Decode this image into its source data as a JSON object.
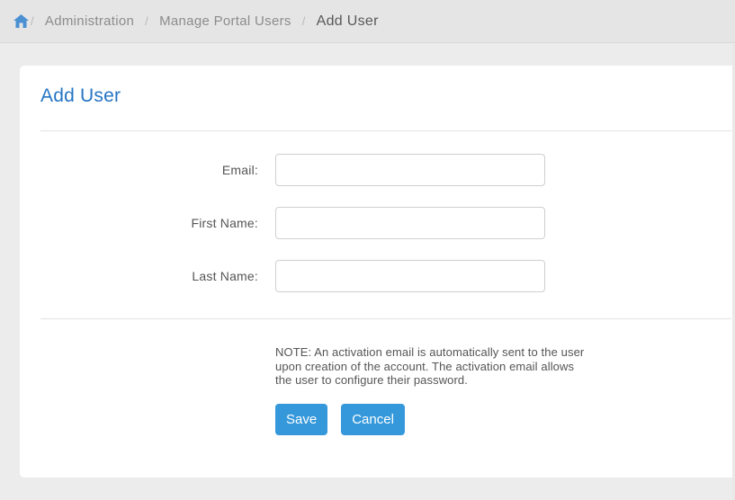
{
  "breadcrumb": {
    "separator": "/",
    "items": [
      {
        "label": "Administration"
      },
      {
        "label": "Manage Portal Users"
      },
      {
        "label": "Add User"
      }
    ]
  },
  "icons": {
    "home": "home-icon"
  },
  "page": {
    "title": "Add User"
  },
  "form": {
    "fields": [
      {
        "label": "Email:",
        "value": "",
        "placeholder": ""
      },
      {
        "label": "First Name:",
        "value": "",
        "placeholder": ""
      },
      {
        "label": "Last Name:",
        "value": "",
        "placeholder": ""
      }
    ],
    "note": "NOTE: An activation email is automatically sent to the user upon creation of the account. The activation email allows the user to configure their password.",
    "buttons": {
      "save": "Save",
      "cancel": "Cancel"
    }
  },
  "colors": {
    "breadcrumb_bg": "#e5e5e5",
    "page_bg": "#ececec",
    "title_blue": "#2575c4",
    "button_blue": "#3598db",
    "home_icon_blue": "#4a90d2",
    "label_gray": "#555555"
  }
}
